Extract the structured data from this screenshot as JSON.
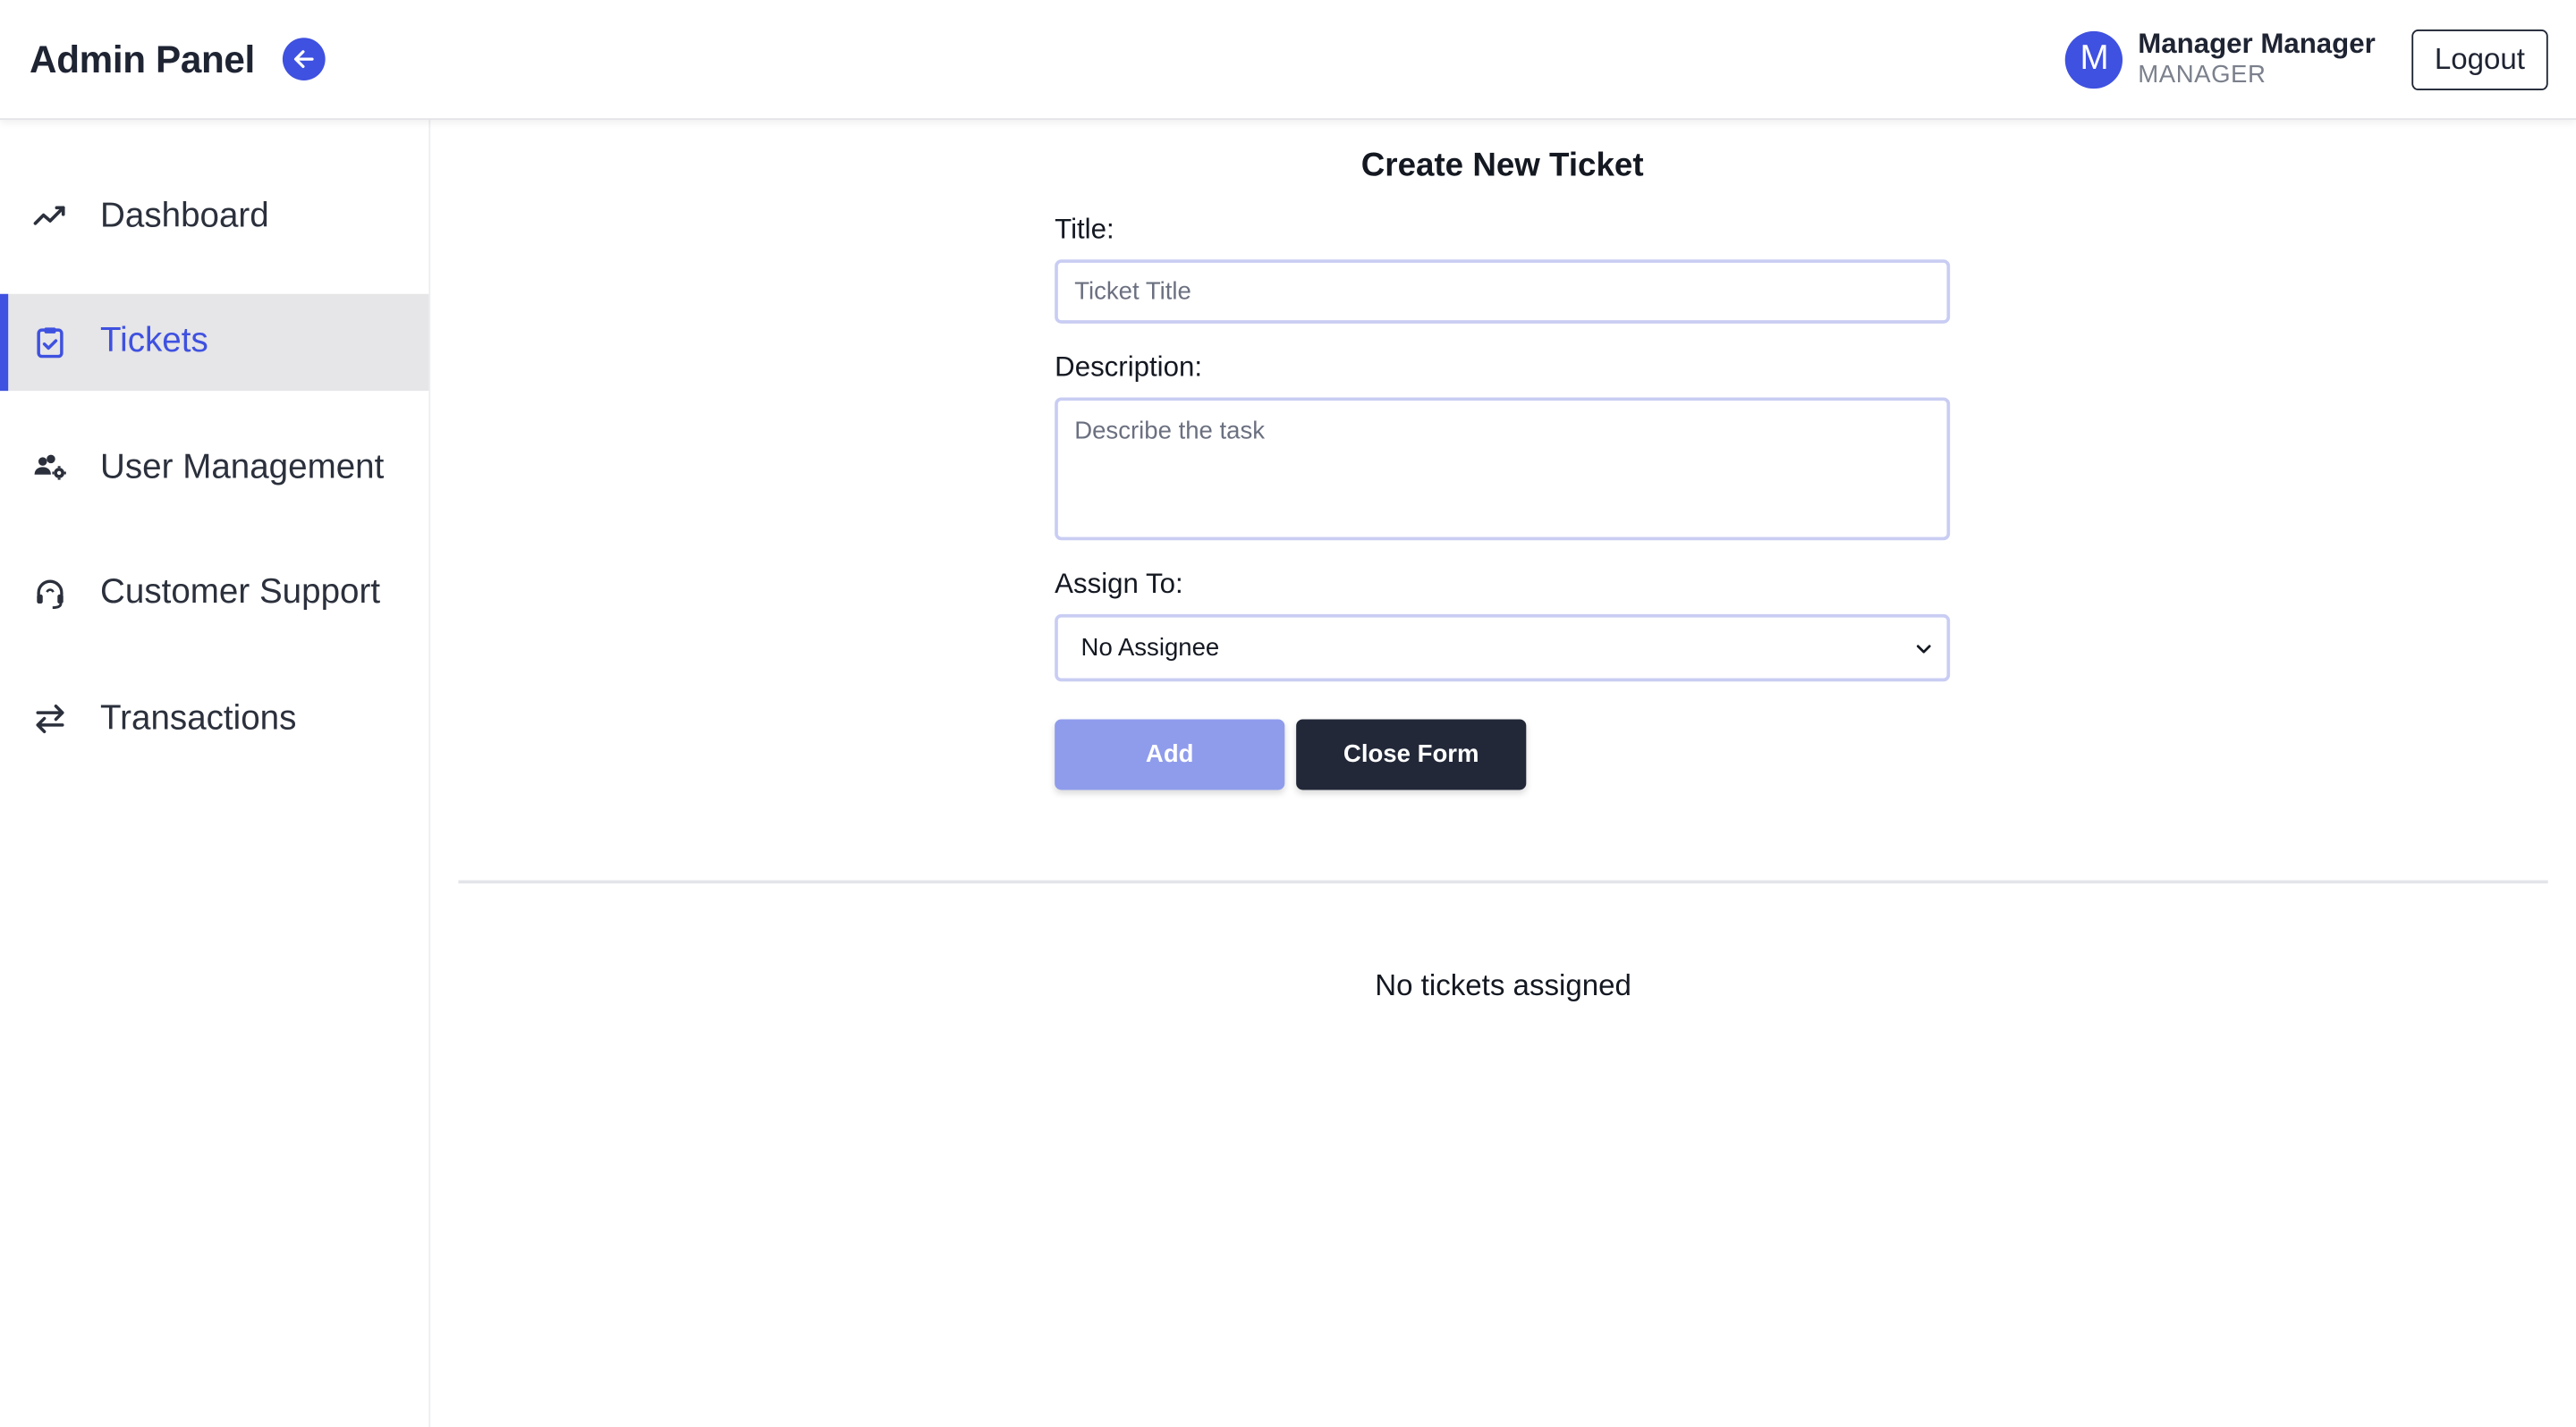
{
  "header": {
    "title": "Admin Panel",
    "back_icon": "arrow-left-icon",
    "user": {
      "initial": "M",
      "name": "Manager Manager",
      "role": "MANAGER"
    },
    "logout_label": "Logout"
  },
  "sidebar": {
    "items": [
      {
        "label": "Dashboard",
        "icon": "trend-chart-icon",
        "active": false
      },
      {
        "label": "Tickets",
        "icon": "clipboard-check-icon",
        "active": true
      },
      {
        "label": "User Management",
        "icon": "users-cog-icon",
        "active": false
      },
      {
        "label": "Customer Support",
        "icon": "headset-icon",
        "active": false
      },
      {
        "label": "Transactions",
        "icon": "swap-arrows-icon",
        "active": false
      }
    ]
  },
  "form": {
    "heading": "Create New Ticket",
    "title_label": "Title:",
    "title_placeholder": "Ticket Title",
    "title_value": "",
    "description_label": "Description:",
    "description_placeholder": "Describe the task",
    "description_value": "",
    "assign_label": "Assign To:",
    "assign_selected": "No Assignee",
    "add_label": "Add",
    "close_label": "Close Form"
  },
  "tickets": {
    "empty_message": "No tickets assigned"
  },
  "colors": {
    "accent": "#3f51e0",
    "add_button": "#8f9cec",
    "close_button": "#222838",
    "active_nav_bg": "#e6e5e7"
  }
}
